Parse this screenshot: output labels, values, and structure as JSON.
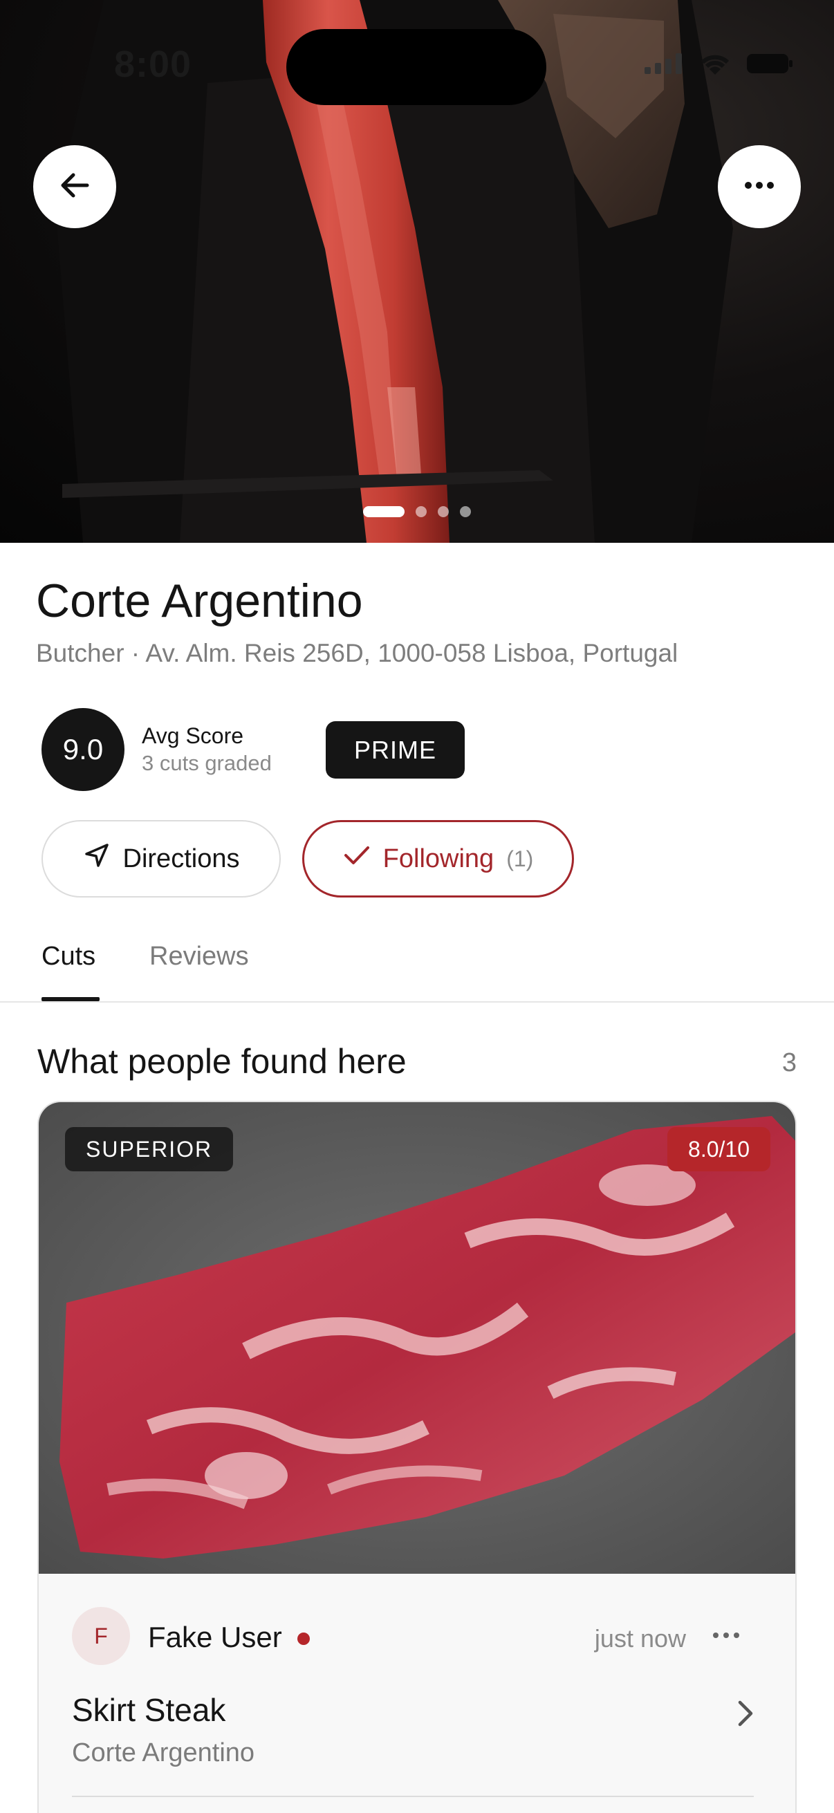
{
  "status_bar": {
    "time": "8:00"
  },
  "hero": {
    "photo_count": 4,
    "active_photo": 1
  },
  "place": {
    "name": "Corte Argentino",
    "subtitle": "Butcher · Av. Alm. Reis 256D, 1000-058 Lisboa, Portugal",
    "avg_score": "9.0",
    "avg_score_label": "Avg Score",
    "cuts_graded": "3 cuts graded",
    "grade_badge": "PRIME"
  },
  "actions": {
    "directions_label": "Directions",
    "following_label": "Following",
    "following_count": "(1)"
  },
  "tabs": [
    {
      "label": "Cuts",
      "active": true
    },
    {
      "label": "Reviews",
      "active": false
    }
  ],
  "section": {
    "title": "What people found here",
    "count": "3"
  },
  "card": {
    "grade": "SUPERIOR",
    "score": "8.0/10",
    "user_initial": "F",
    "user_name": "Fake User",
    "time": "just now",
    "cut_name": "Skirt Steak",
    "shop": "Corte Argentino"
  },
  "colors": {
    "accent_red": "#a3262b",
    "dark": "#151515",
    "muted": "#7b7b7b"
  }
}
